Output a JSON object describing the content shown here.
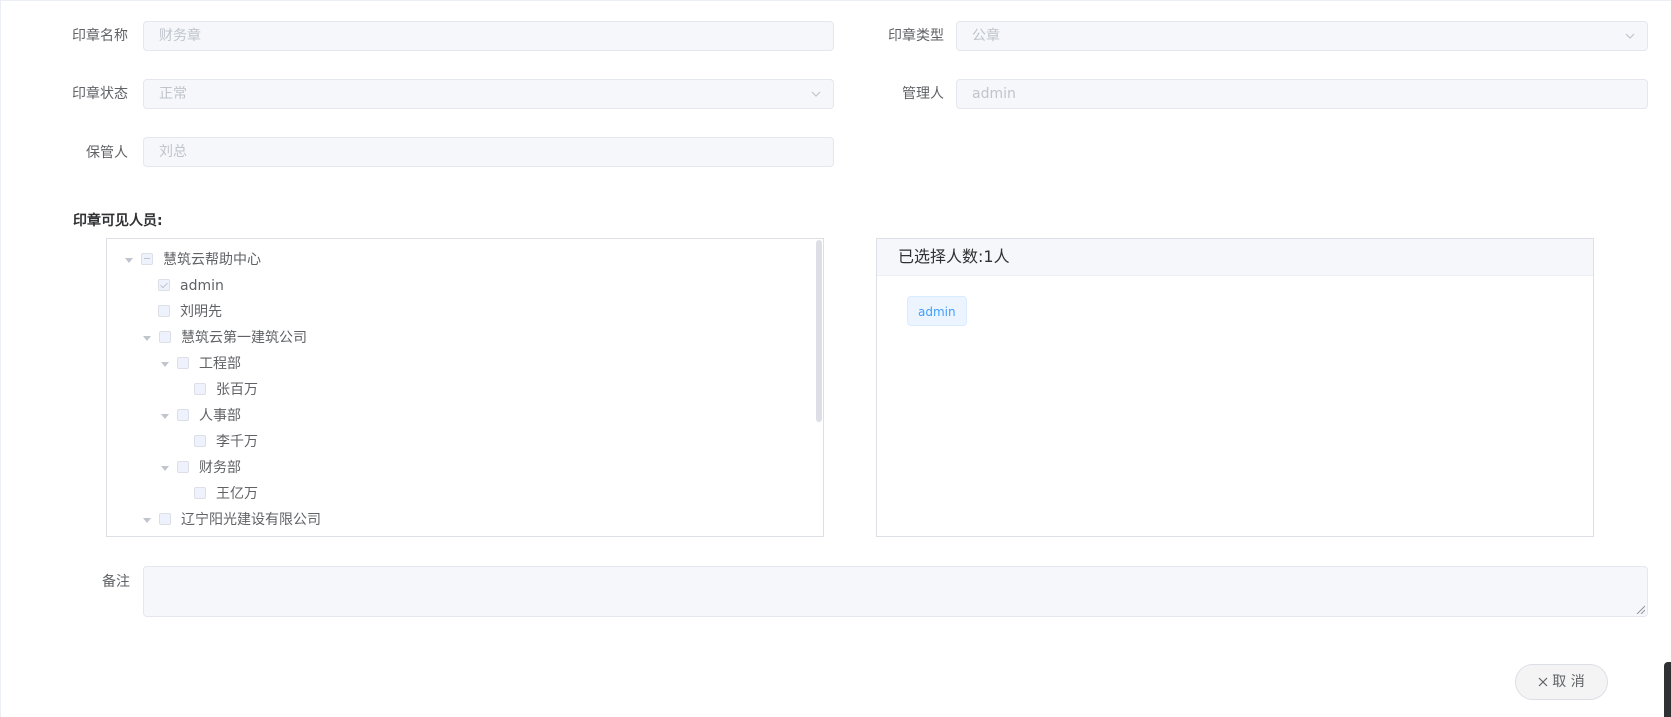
{
  "form": {
    "seal_name_label": "印章名称",
    "seal_name_value": "财务章",
    "seal_type_label": "印章类型",
    "seal_type_value": "公章",
    "seal_status_label": "印章状态",
    "seal_status_value": "正常",
    "manager_label": "管理人",
    "manager_value": "admin",
    "keeper_label": "保管人",
    "keeper_value": "刘总",
    "visible_section_title": "印章可见人员:",
    "remark_label": "备注",
    "remark_value": ""
  },
  "tree": {
    "nodes": [
      {
        "label": "慧筑云帮助中心",
        "state": "indeterminate",
        "expanded": true
      },
      {
        "label": "admin",
        "state": "checked"
      },
      {
        "label": "刘明先",
        "state": "unchecked"
      },
      {
        "label": "慧筑云第一建筑公司",
        "state": "unchecked",
        "expanded": true
      },
      {
        "label": "工程部",
        "state": "unchecked",
        "expanded": true
      },
      {
        "label": "张百万",
        "state": "unchecked"
      },
      {
        "label": "人事部",
        "state": "unchecked",
        "expanded": true
      },
      {
        "label": "李千万",
        "state": "unchecked"
      },
      {
        "label": "财务部",
        "state": "unchecked",
        "expanded": true
      },
      {
        "label": "王亿万",
        "state": "unchecked"
      },
      {
        "label": "辽宁阳光建设有限公司",
        "state": "unchecked",
        "expanded": true
      }
    ]
  },
  "selected": {
    "header": "已选择人数:1人",
    "tags": [
      "admin"
    ]
  },
  "actions": {
    "cancel_label": "取 消"
  },
  "icons": {
    "select_arrow": "chevron-down-icon",
    "tree_caret": "caret-down-icon",
    "cancel": "close-icon",
    "resize": "resize-handle-icon"
  },
  "colors": {
    "disabled_bg": "#f5f7fa",
    "disabled_text": "#c0c4cc",
    "tag_text": "#409eff",
    "tag_bg": "#ecf5ff"
  }
}
